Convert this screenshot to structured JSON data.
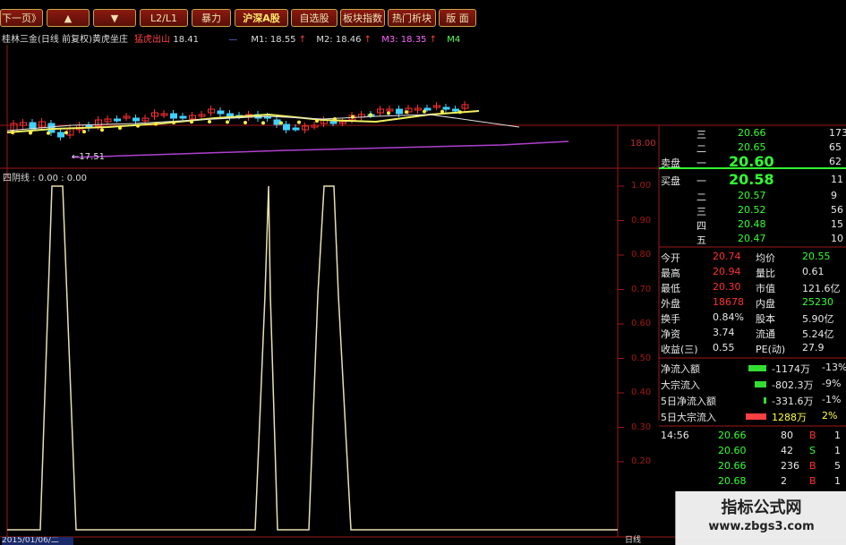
{
  "toolbar": {
    "buttons": [
      "下一页》",
      "▲",
      "▼",
      "L2/L1",
      "暴力",
      "沪深A股",
      "自选股",
      "板块指数",
      "热门析块",
      "版 面"
    ]
  },
  "chart": {
    "title": "桂林三金(日线 前复权)黄虎坐庄",
    "indicator_label": "猛虎出山",
    "indicator_value": "18.41",
    "ma_labels": [
      "M1: 18.55",
      "M2: 18.46",
      "M3: 18.35",
      "M4"
    ],
    "low_marker": "17.51",
    "price_tick": "18.00",
    "sub_title": "四阴线 : 0.00 : 0.00",
    "y_ticks": [
      "1.00",
      "0.90",
      "0.80",
      "0.70",
      "0.60",
      "0.50",
      "0.40",
      "0.30",
      "0.20"
    ],
    "date_label": "2015/01/06/二",
    "period_label": "日线",
    "colors": {
      "grid": "#a01818",
      "candle_up": "#ff3030",
      "candle_down": "#40d0ff",
      "ma_yellow": "#f0f060",
      "ma_white": "#e0e0e0",
      "ma_purple": "#b040d0",
      "signal_line": "#e8e0b0"
    }
  },
  "orderbook": {
    "sells": [
      {
        "level": "三",
        "price": "20.66",
        "vol": "173"
      },
      {
        "level": "二",
        "price": "20.65",
        "vol": "65"
      },
      {
        "level": "一",
        "price": "20.60",
        "vol": "62"
      }
    ],
    "sell_label": "卖盘",
    "buy_label": "买盘",
    "buys": [
      {
        "level": "一",
        "price": "20.58",
        "vol": "11"
      },
      {
        "level": "二",
        "price": "20.57",
        "vol": "9"
      },
      {
        "level": "三",
        "price": "20.52",
        "vol": "56"
      },
      {
        "level": "四",
        "price": "20.48",
        "vol": "15"
      },
      {
        "level": "五",
        "price": "20.47",
        "vol": "10"
      }
    ]
  },
  "stats": [
    {
      "l1": "今开",
      "v1": "20.74",
      "l2": "均价",
      "v2": "20.55"
    },
    {
      "l1": "最高",
      "v1": "20.94",
      "l2": "量比",
      "v2": "0.61"
    },
    {
      "l1": "最低",
      "v1": "20.30",
      "l2": "市值",
      "v2": "121.6亿"
    },
    {
      "l1": "外盘",
      "v1": "18678",
      "l2": "内盘",
      "v2": "25230"
    },
    {
      "l1": "换手",
      "v1": "0.84%",
      "l2": "股本",
      "v2": "5.90亿"
    },
    {
      "l1": "净资",
      "v1": "3.74",
      "l2": "流通",
      "v2": "5.24亿"
    },
    {
      "l1": "收益(三)",
      "v1": "0.55",
      "l2": "PE(动)",
      "v2": "27.9"
    }
  ],
  "flows": [
    {
      "label": "净流入额",
      "value": "-1174万",
      "pct": "-13%",
      "color": "#33dd33",
      "bar": 0.75
    },
    {
      "label": "大宗流入",
      "value": "-802.3万",
      "pct": "-9%",
      "color": "#33dd33",
      "bar": 0.5
    },
    {
      "label": "5日净流入额",
      "value": "-331.6万",
      "pct": "-1%",
      "color": "#33dd33",
      "bar": 0.1
    },
    {
      "label": "5日大宗流入",
      "value": "1288万",
      "pct": "2%",
      "color": "#ff4040",
      "bar": 0.9
    }
  ],
  "ticks": [
    {
      "time": "14:56",
      "price": "20.66",
      "vol": "80",
      "side": "B",
      "n": "1"
    },
    {
      "time": "",
      "price": "20.60",
      "vol": "42",
      "side": "S",
      "n": "1"
    },
    {
      "time": "",
      "price": "20.66",
      "vol": "236",
      "side": "B",
      "n": "5"
    },
    {
      "time": "",
      "price": "20.68",
      "vol": "2",
      "side": "B",
      "n": "1"
    }
  ],
  "watermark": {
    "title": "指标公式网",
    "url": "www.zbgs3.com"
  }
}
